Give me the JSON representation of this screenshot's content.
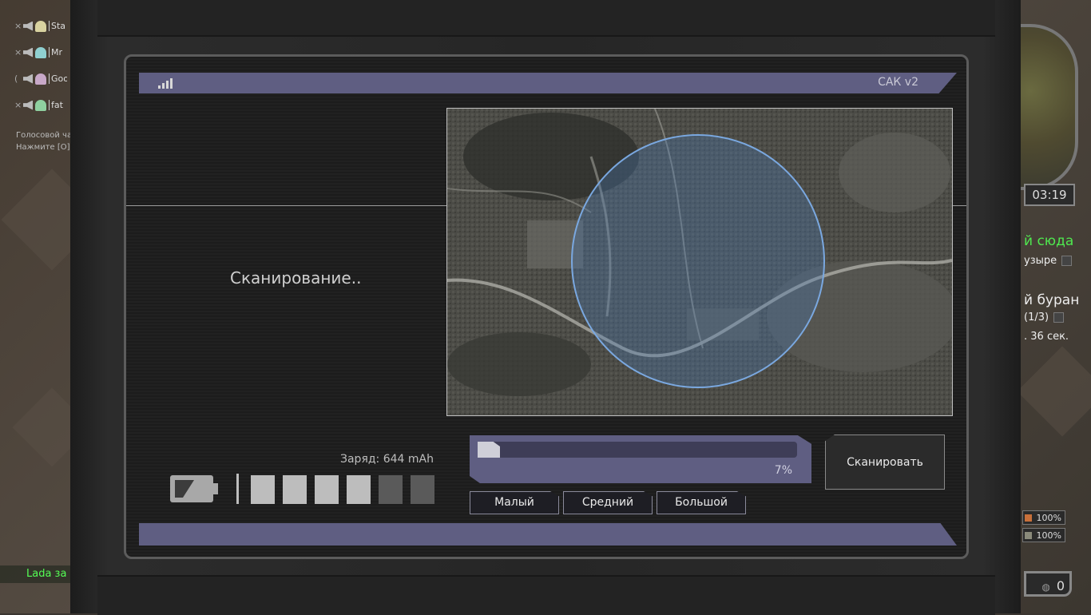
{
  "voice_chat": {
    "users": [
      {
        "name": "Sta",
        "avatar_color": "#d8d2a0",
        "status": "muted"
      },
      {
        "name": "Mr",
        "avatar_color": "#8fd0d0",
        "status": "muted"
      },
      {
        "name": "Goo",
        "avatar_color": "#c8a8c8",
        "status": "speaking"
      },
      {
        "name": "fat",
        "avatar_color": "#8fd0a0",
        "status": "muted"
      }
    ],
    "hint_line1": "Голосовой ча",
    "hint_line2": "Нажмите [O]"
  },
  "chat_notice": "Lada за",
  "hud": {
    "time": "03:19",
    "task1_title": "й сюда",
    "task1_sub": "узыре",
    "task2_title": "й буран",
    "task2_sub": "(1/3)",
    "task2_timer": ". 36 сек.",
    "stat1": "100%",
    "stat1_color": "#c8703a",
    "stat2": "100%",
    "stat2_color": "#8a8a7a",
    "money": "0"
  },
  "device": {
    "title": "САК v2",
    "status_text": "Сканирование..",
    "charge_label": "Заряд: 644 mAh",
    "battery_cells": [
      true,
      true,
      true,
      true,
      false,
      false
    ],
    "progress_percent": 7,
    "progress_label": "7%",
    "radius_options": [
      "Малый",
      "Средний",
      "Большой"
    ],
    "scan_button": "Сканировать"
  }
}
